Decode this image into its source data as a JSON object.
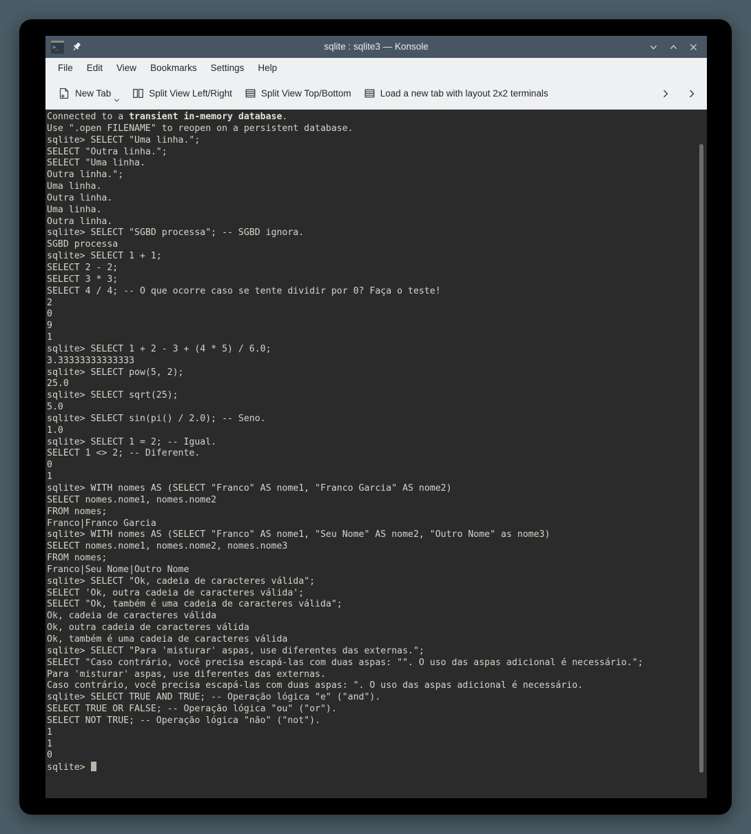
{
  "window": {
    "title": "sqlite : sqlite3 — Konsole",
    "app_icon": "konsole-icon",
    "pin_icon": "pin-icon",
    "controls": [
      {
        "name": "minimize-button",
        "icon": "chevron-down-icon"
      },
      {
        "name": "maximize-button",
        "icon": "chevron-up-icon"
      },
      {
        "name": "close-button",
        "icon": "close-icon"
      }
    ]
  },
  "menubar": {
    "items": [
      {
        "label": "File"
      },
      {
        "label": "Edit"
      },
      {
        "label": "View"
      },
      {
        "label": "Bookmarks"
      },
      {
        "label": "Settings"
      },
      {
        "label": "Help"
      }
    ]
  },
  "toolbar": {
    "buttons": [
      {
        "label": "New Tab",
        "icon": "new-tab-icon",
        "has_dropdown": true
      },
      {
        "label": "Split View Left/Right",
        "icon": "split-left-right-icon",
        "has_dropdown": false
      },
      {
        "label": "Split View Top/Bottom",
        "icon": "split-top-bottom-icon",
        "has_dropdown": false
      },
      {
        "label": "Load a new tab with layout 2x2 terminals",
        "icon": "layout-2x2-icon",
        "has_dropdown": false
      }
    ],
    "overflow_icons": [
      "chevron-right-icon",
      "chevron-right-icon"
    ]
  },
  "terminal": {
    "prompt": "sqlite> ",
    "colors": {
      "background": "#2b2b2b",
      "foreground": "#d6d3c8",
      "titlebar": "#485563",
      "chrome": "#eff0f1",
      "desktop": "#4a5c66",
      "frame": "#000000",
      "scrollbar_thumb": "#6d6d68",
      "cursor": "#b8b5ab"
    },
    "lines": [
      {
        "text": "Connected to a "
      },
      {
        "text": "Use \".open FILENAME\" to reopen on a persistent database."
      },
      {
        "text": "sqlite> SELECT \"Uma linha.\";"
      },
      {
        "text": "SELECT \"Outra linha.\";"
      },
      {
        "text": "SELECT \"Uma linha."
      },
      {
        "text": "Outra linha.\";"
      },
      {
        "text": "Uma linha."
      },
      {
        "text": "Outra linha."
      },
      {
        "text": "Uma linha."
      },
      {
        "text": "Outra linha."
      },
      {
        "text": "sqlite> SELECT \"SGBD processa\"; -- SGBD ignora."
      },
      {
        "text": "SGBD processa"
      },
      {
        "text": "sqlite> SELECT 1 + 1;"
      },
      {
        "text": "SELECT 2 - 2;"
      },
      {
        "text": "SELECT 3 * 3;"
      },
      {
        "text": "SELECT 4 / 4; -- O que ocorre caso se tente dividir por 0? Faça o teste!"
      },
      {
        "text": "2"
      },
      {
        "text": "0"
      },
      {
        "text": "9"
      },
      {
        "text": "1"
      },
      {
        "text": "sqlite> SELECT 1 + 2 - 3 + (4 * 5) / 6.0;"
      },
      {
        "text": "3.33333333333333"
      },
      {
        "text": "sqlite> SELECT pow(5, 2);"
      },
      {
        "text": "25.0"
      },
      {
        "text": "sqlite> SELECT sqrt(25);"
      },
      {
        "text": "5.0"
      },
      {
        "text": "sqlite> SELECT sin(pi() / 2.0); -- Seno."
      },
      {
        "text": "1.0"
      },
      {
        "text": "sqlite> SELECT 1 = 2; -- Igual."
      },
      {
        "text": "SELECT 1 <> 2; -- Diferente."
      },
      {
        "text": "0"
      },
      {
        "text": "1"
      },
      {
        "text": "sqlite> WITH nomes AS (SELECT \"Franco\" AS nome1, \"Franco Garcia\" AS nome2)"
      },
      {
        "text": "SELECT nomes.nome1, nomes.nome2"
      },
      {
        "text": "FROM nomes;"
      },
      {
        "text": "Franco|Franco Garcia"
      },
      {
        "text": "sqlite> WITH nomes AS (SELECT \"Franco\" AS nome1, \"Seu Nome\" AS nome2, \"Outro Nome\" as nome3)"
      },
      {
        "text": "SELECT nomes.nome1, nomes.nome2, nomes.nome3"
      },
      {
        "text": "FROM nomes;"
      },
      {
        "text": "Franco|Seu Nome|Outro Nome"
      },
      {
        "text": "sqlite> SELECT \"Ok, cadeia de caracteres válida\";"
      },
      {
        "text": "SELECT 'Ok, outra cadeia de caracteres válida';"
      },
      {
        "text": "SELECT \"Ok, também é uma cadeia de caracteres válida\";"
      },
      {
        "text": "Ok, cadeia de caracteres válida"
      },
      {
        "text": "Ok, outra cadeia de caracteres válida"
      },
      {
        "text": "Ok, também é uma cadeia de caracteres válida"
      },
      {
        "text": "sqlite> SELECT \"Para 'misturar' aspas, use diferentes das externas.\";"
      },
      {
        "text": "SELECT \"Caso contrário, você precisa escapá-las com duas aspas: \"\". O uso das aspas adicional é necessário.\";"
      },
      {
        "text": "Para 'misturar' aspas, use diferentes das externas."
      },
      {
        "text": "Caso contrário, você precisa escapá-las com duas aspas: \". O uso das aspas adicional é necessário."
      },
      {
        "text": "sqlite> SELECT TRUE AND TRUE; -- Operação lógica \"e\" (\"and\")."
      },
      {
        "text": "SELECT TRUE OR FALSE; -- Operação lógica \"ou\" (\"or\")."
      },
      {
        "text": "SELECT NOT TRUE; -- Operação lógica \"não\" (\"not\")."
      },
      {
        "text": "1"
      },
      {
        "text": "1"
      },
      {
        "text": "0"
      },
      {
        "text": "sqlite> "
      }
    ],
    "first_line_plain_prefix": "Connected to a ",
    "first_line_bold": "transient in-memory database",
    "first_line_suffix": "."
  }
}
